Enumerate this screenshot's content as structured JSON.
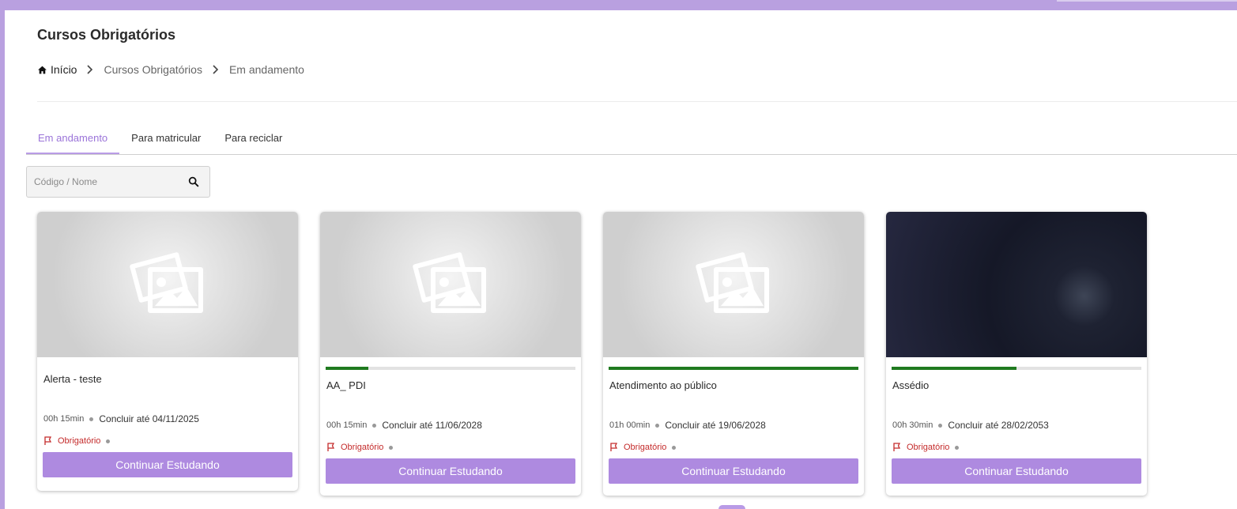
{
  "header": {
    "title": "Cursos Obrigatórios"
  },
  "breadcrumb": {
    "home": "Início",
    "items": [
      "Cursos Obrigatórios",
      "Em andamento"
    ]
  },
  "tabs": [
    {
      "label": "Em andamento",
      "active": true
    },
    {
      "label": "Para matricular",
      "active": false
    },
    {
      "label": "Para reciclar",
      "active": false
    }
  ],
  "search": {
    "placeholder": "Código / Nome",
    "value": ""
  },
  "colors": {
    "accent": "#ae8ae0",
    "progress": "#1f7a1f",
    "tag": "#c42b2b"
  },
  "cards": [
    {
      "title": "Alerta - teste",
      "duration": "00h 15min",
      "deadline": "Concluir até 04/11/2025",
      "tag": "Obrigatório",
      "button": "Continuar Estudando",
      "image": "placeholder",
      "progress": null
    },
    {
      "title": "AA_ PDI",
      "duration": "00h 15min",
      "deadline": "Concluir até 11/06/2028",
      "tag": "Obrigatório",
      "button": "Continuar Estudando",
      "image": "placeholder",
      "progress": 0.17
    },
    {
      "title": "Atendimento ao público",
      "duration": "01h 00min",
      "deadline": "Concluir até 19/06/2028",
      "tag": "Obrigatório",
      "button": "Continuar Estudando",
      "image": "placeholder",
      "progress": 1.0
    },
    {
      "title": "Assédio",
      "duration": "00h 30min",
      "deadline": "Concluir até 28/02/2053",
      "tag": "Obrigatório",
      "button": "Continuar Estudando",
      "image": "photo-dark",
      "progress": 0.5
    }
  ],
  "icons": {
    "home": "home-icon",
    "separator": "chevron-right-icon",
    "search": "search-icon",
    "image_placeholder": "image-placeholder-icon",
    "flag": "flag-icon"
  }
}
